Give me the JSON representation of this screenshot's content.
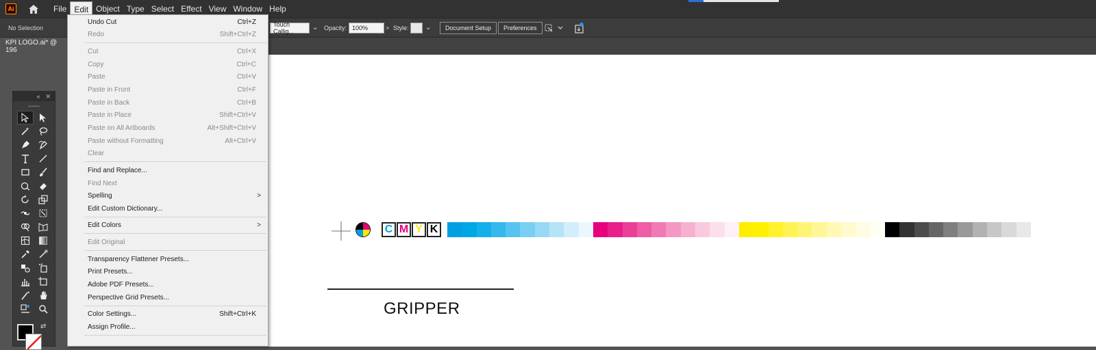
{
  "app": {
    "logo_text": "Ai"
  },
  "menubar": {
    "items": [
      "File",
      "Edit",
      "Object",
      "Type",
      "Select",
      "Effect",
      "View",
      "Window",
      "Help"
    ],
    "active": "Edit"
  },
  "controlbar": {
    "selection_status": "No Selection",
    "brush_value": "Touch Callig...",
    "opacity_label": "Opacity:",
    "opacity_value": "100%",
    "style_label": "Style:",
    "document_setup": "Document Setup",
    "preferences": "Preferences"
  },
  "document": {
    "tab_title": "KPI LOGO.ai* @ 196"
  },
  "canvas": {
    "cmyk_letters": [
      {
        "char": "C",
        "color": "#00a0e3"
      },
      {
        "char": "M",
        "color": "#e6007e"
      },
      {
        "char": "Y",
        "color": "#ffe600"
      },
      {
        "char": "K",
        "color": "#000000"
      }
    ],
    "swatch_groups": [
      [
        "#00a0e3",
        "#00a7e6",
        "#15b0ea",
        "#35b9ec",
        "#57c4ef",
        "#79cff2",
        "#97d9f4",
        "#b5e3f7",
        "#d2eefa",
        "#ebf7fd"
      ],
      [
        "#e6007e",
        "#e81e8a",
        "#eb3e97",
        "#ee5da5",
        "#f17ab4",
        "#f497c3",
        "#f6b1d1",
        "#f9c9df",
        "#fbdfec",
        "#fdf0f6"
      ],
      [
        "#ffed00",
        "#fff000",
        "#fff22b",
        "#fff352",
        "#fff575",
        "#fff797",
        "#fff9b5",
        "#fffbcf",
        "#fffce3",
        "#fffef3"
      ],
      [
        "#000000",
        "#333333",
        "#4c4c4c",
        "#666666",
        "#7f7f7f",
        "#999999",
        "#b2b2b2",
        "#c7c7c7",
        "#d9d9d9",
        "#e8e8e8"
      ]
    ],
    "gripper_label": "GRIPPER"
  },
  "edit_menu": {
    "items": [
      {
        "label": "Undo Cut",
        "shortcut": "Ctrl+Z",
        "disabled": false
      },
      {
        "label": "Redo",
        "shortcut": "Shift+Ctrl+Z",
        "disabled": true
      },
      {
        "label": "Cut",
        "shortcut": "Ctrl+X",
        "disabled": true
      },
      {
        "label": "Copy",
        "shortcut": "Ctrl+C",
        "disabled": true
      },
      {
        "label": "Paste",
        "shortcut": "Ctrl+V",
        "disabled": true
      },
      {
        "label": "Paste in Front",
        "shortcut": "Ctrl+F",
        "disabled": true
      },
      {
        "label": "Paste in Back",
        "shortcut": "Ctrl+B",
        "disabled": true
      },
      {
        "label": "Paste in Place",
        "shortcut": "Shift+Ctrl+V",
        "disabled": true
      },
      {
        "label": "Paste on All Artboards",
        "shortcut": "Alt+Shift+Ctrl+V",
        "disabled": true
      },
      {
        "label": "Paste without Formatting",
        "shortcut": "Alt+Ctrl+V",
        "disabled": true
      },
      {
        "label": "Clear",
        "shortcut": "",
        "disabled": true
      },
      {
        "label": "Find and Replace...",
        "shortcut": "",
        "disabled": false
      },
      {
        "label": "Find Next",
        "shortcut": "",
        "disabled": true
      },
      {
        "label": "Spelling",
        "shortcut": "",
        "disabled": false,
        "submenu": true
      },
      {
        "label": "Edit Custom Dictionary...",
        "shortcut": "",
        "disabled": false
      },
      {
        "label": "Edit Colors",
        "shortcut": "",
        "disabled": false,
        "submenu": true
      },
      {
        "label": "Edit Original",
        "shortcut": "",
        "disabled": true
      },
      {
        "label": "Transparency Flattener Presets...",
        "shortcut": "",
        "disabled": false
      },
      {
        "label": "Print Presets...",
        "shortcut": "",
        "disabled": false
      },
      {
        "label": "Adobe PDF Presets...",
        "shortcut": "",
        "disabled": false
      },
      {
        "label": "Perspective Grid Presets...",
        "shortcut": "",
        "disabled": false
      },
      {
        "label": "Color Settings...",
        "shortcut": "Shift+Ctrl+K",
        "disabled": false
      },
      {
        "label": "Assign Profile...",
        "shortcut": "",
        "disabled": false
      }
    ]
  },
  "colors": {
    "accent": "#2d6fd6",
    "menu_bg": "#f0f0f0",
    "app_bg": "#535353"
  }
}
